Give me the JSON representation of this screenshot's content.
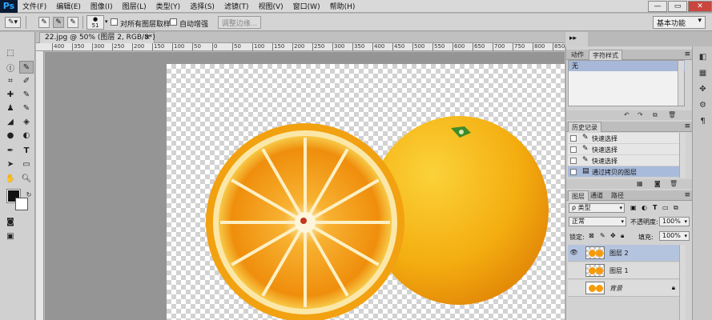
{
  "app": {
    "logo": "Ps"
  },
  "menu": [
    "文件(F)",
    "编辑(E)",
    "图像(I)",
    "图层(L)",
    "类型(Y)",
    "选择(S)",
    "滤镜(T)",
    "视图(V)",
    "窗口(W)",
    "帮助(H)"
  ],
  "window_controls": {
    "minimize": "—",
    "restore": "▭",
    "close": "✕"
  },
  "options_bar": {
    "brush_size": "51",
    "sample_all_layers": "对所有图层取样",
    "auto_enhance": "自动增强",
    "refine_edge": "调整边缘...",
    "workspace": "基本功能"
  },
  "document": {
    "tab_title": "22.jpg @ 50% (图层 2, RGB/8*)",
    "close_glyph": "×",
    "ruler_labels": [
      "400",
      "350",
      "300",
      "250",
      "200",
      "150",
      "100",
      "50",
      "0",
      "50",
      "100",
      "150",
      "200",
      "250",
      "300",
      "350",
      "400",
      "450",
      "500",
      "550",
      "600",
      "650",
      "700",
      "750",
      "800",
      "850"
    ]
  },
  "panels": {
    "actions": {
      "tabs": [
        "动作",
        "字符样式"
      ],
      "selected_item": "无"
    },
    "history": {
      "tab": "历史记录",
      "rows": [
        {
          "label": "快速选择",
          "selected": false
        },
        {
          "label": "快速选择",
          "selected": false
        },
        {
          "label": "快速选择",
          "selected": false
        },
        {
          "label": "通过拷贝的图层",
          "selected": true
        }
      ]
    },
    "layers": {
      "tabs": [
        "图层",
        "通道",
        "路径"
      ],
      "filter_kind": "ρ 类型",
      "blend_mode": "正常",
      "opacity_label": "不透明度:",
      "opacity_value": "100%",
      "lock_label": "锁定:",
      "fill_label": "填充:",
      "fill_value": "100%",
      "layers": [
        {
          "name": "图层 2",
          "visible": true,
          "selected": true
        },
        {
          "name": "图层 1",
          "visible": false,
          "selected": false
        },
        {
          "name": "背景",
          "visible": false,
          "selected": false,
          "locked": true
        }
      ]
    }
  },
  "colors": {
    "foreground": "#111111",
    "background": "#ffffff",
    "orange_light": "#f6b10f",
    "orange_dark": "#e8890a",
    "selection": "#a9bbdb"
  }
}
